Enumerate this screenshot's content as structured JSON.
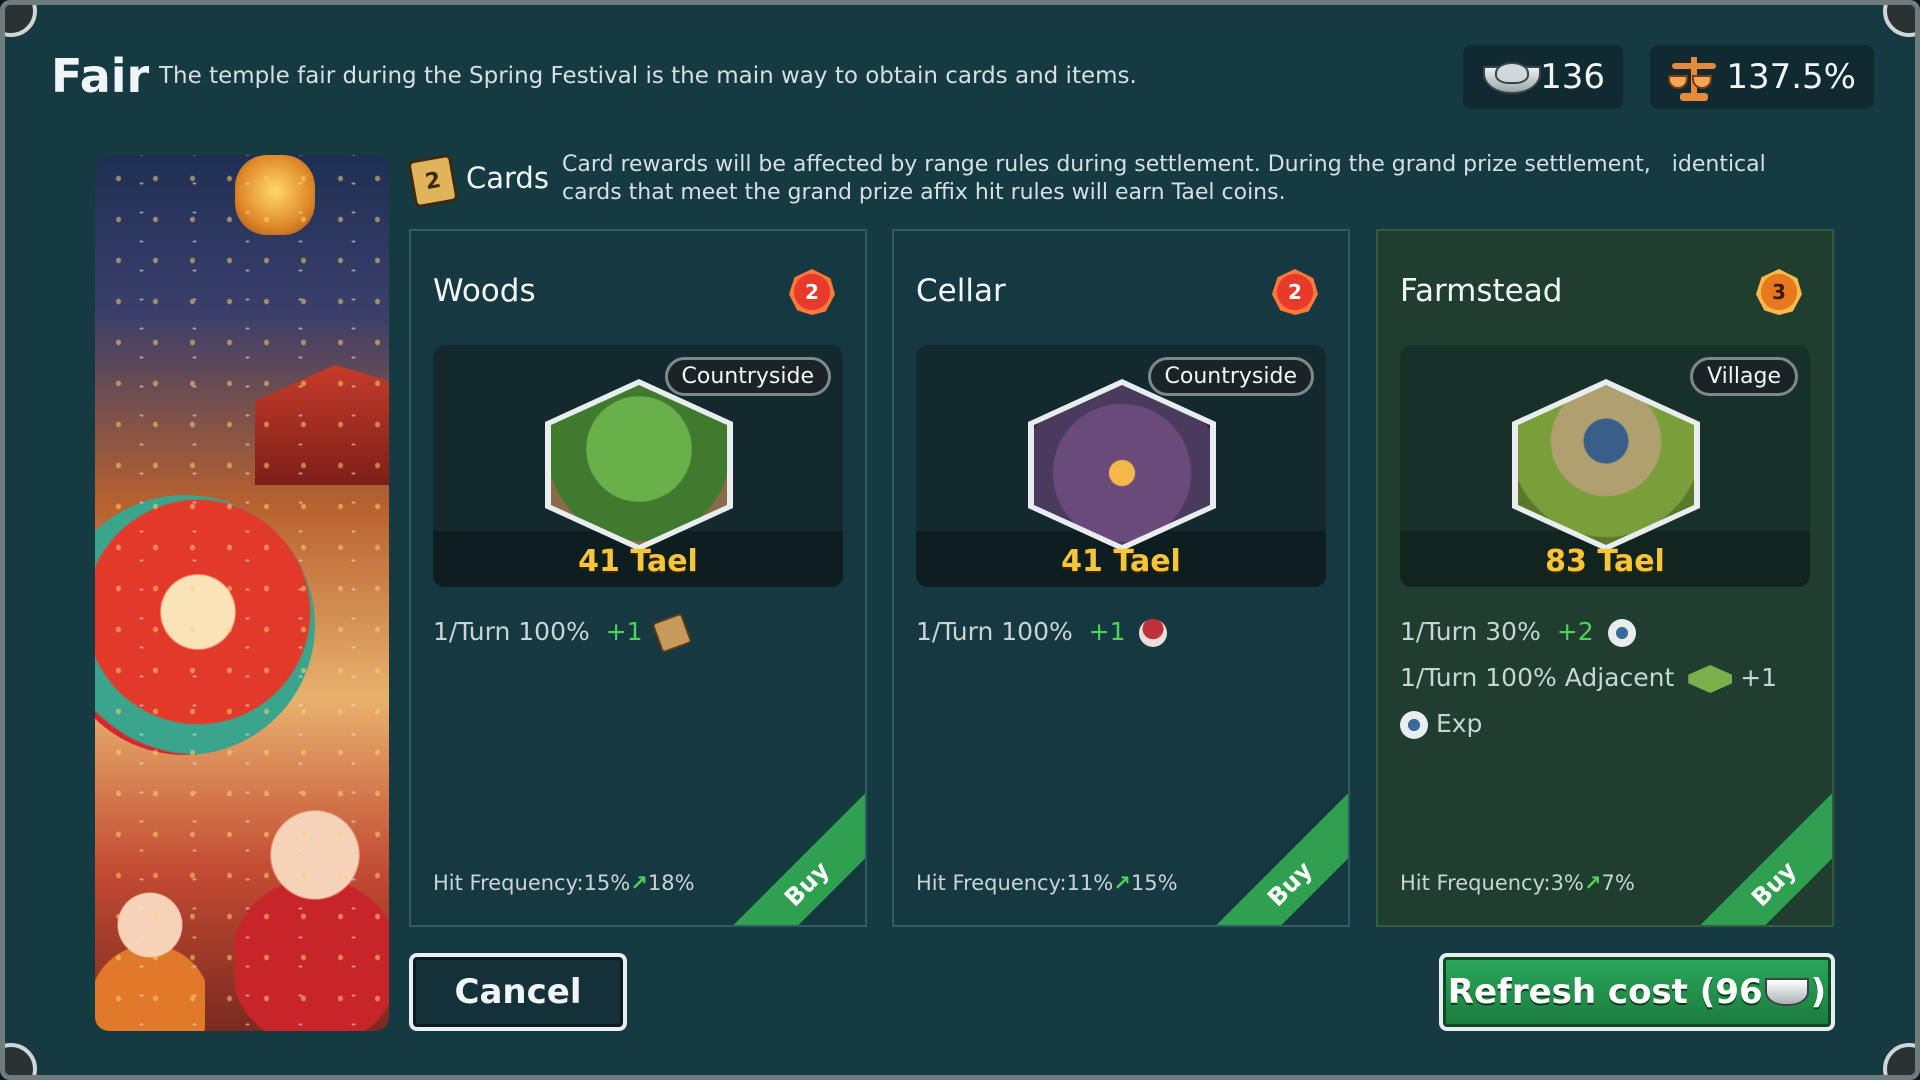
{
  "header": {
    "title": "Fair",
    "subtitle": "The temple fair during the Spring Festival is the main way to obtain cards and items.",
    "silver": "136",
    "silver_icon": "silver-ingot-icon",
    "rate": "137.5%",
    "rate_icon": "scale-icon"
  },
  "cards_section": {
    "label": "Cards",
    "icon": "cards-icon",
    "description": "Card rewards will be affected by range rules during settlement. During the grand prize settlement,   identical cards that meet the grand prize affix hit rules will earn Tael coins."
  },
  "cards": [
    {
      "name": "Woods",
      "level": "2",
      "tag": "Countryside",
      "price": "41 Tael",
      "effects": [
        {
          "text": "1/Turn 100%",
          "plus": "+1",
          "icon": "wood-plank-icon"
        }
      ],
      "hit_from": "Hit Frequency:15%",
      "hit_to": "18%",
      "buy": "Buy"
    },
    {
      "name": "Cellar",
      "level": "2",
      "tag": "Countryside",
      "price": "41 Tael",
      "effects": [
        {
          "text": "1/Turn 100%",
          "plus": "+1",
          "icon": "mushroom-icon"
        }
      ],
      "hit_from": "Hit Frequency:11%",
      "hit_to": "15%",
      "buy": "Buy"
    },
    {
      "name": "Farmstead",
      "level": "3",
      "tag": "Village",
      "price": "83 Tael",
      "effects": [
        {
          "text": "1/Turn 30%",
          "plus": "+2",
          "icon": "exp-disc-icon"
        },
        {
          "text": "1/Turn 100% Adjacent",
          "plus": "+1",
          "icon": "grassland-icon"
        },
        {
          "text": "Exp",
          "icon": "exp-disc-icon"
        }
      ],
      "hit_from": "Hit Frequency:3%",
      "hit_to": "7%",
      "buy": "Buy"
    }
  ],
  "buttons": {
    "cancel": "Cancel",
    "refresh_prefix": "Refresh cost (96",
    "refresh_suffix": ")"
  },
  "colors": {
    "background": "#163a42",
    "price": "#f5c63a",
    "positive": "#4fd25a",
    "buy_ribbon": "#2fa050",
    "refresh_button": "#2aa85a"
  }
}
